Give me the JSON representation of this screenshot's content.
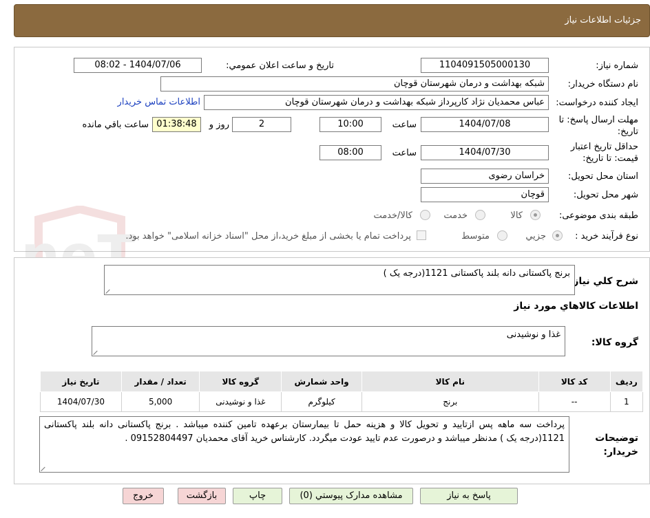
{
  "header": {
    "title": "جزئیات اطلاعات نیاز"
  },
  "watermark": {
    "text": "AriaTender.neT"
  },
  "form": {
    "need_number_label": "شماره نیاز:",
    "need_number": "1104091505000130",
    "announce_label": "تاریخ و ساعت اعلان عمومي:",
    "announce_value": "1404/07/06 - 08:02",
    "buyer_label": "نام دستگاه خریدار:",
    "buyer_value": "شبکه بهداشت و درمان شهرستان قوچان",
    "creator_label": "ایجاد کننده درخواست:",
    "creator_value": "عباس محمدیان نژاد کارپرداز شبکه بهداشت و درمان شهرستان قوچان",
    "contact_link": "اطلاعات تماس خریدار",
    "deadline_label": "مهلت ارسال پاسخ: تا تاریخ:",
    "deadline_date": "1404/07/08",
    "time_label": "ساعت",
    "deadline_time": "10:00",
    "days_value": "2",
    "days_label": "روز و",
    "remaining_value": "01:38:48",
    "remaining_label": "ساعت باقي مانده",
    "validity_label": "حداقل تاریخ اعتبار قیمت: تا تاریخ:",
    "validity_date": "1404/07/30",
    "validity_time": "08:00",
    "province_label": "استان محل تحویل:",
    "province_value": "خراسان رضوی",
    "city_label": "شهر محل تحویل:",
    "city_value": "قوچان",
    "category_label": "طبقه بندی موضوعی:",
    "category_options": [
      "کالا",
      "خدمت",
      "کالا/خدمت"
    ],
    "process_label": "نوع فرآیند خرید :",
    "process_options": [
      "جزیي",
      "متوسط"
    ],
    "process_note": "پرداخت تمام یا بخشی از مبلغ خرید،از محل \"اسناد خزانه اسلامی\" خواهد بود."
  },
  "details": {
    "summary_label": "شرح کلي نیاز:",
    "summary_value": "برنج پاکستانی دانه بلند پاکستانی 1121(درجه یک )",
    "goods_info_title": "اطلاعات کالاهاي مورد نیاز",
    "goods_group_label": "گروه کالا:",
    "goods_group_value": "غذا و نوشیدنی",
    "table": {
      "headers": [
        "ردیف",
        "کد کالا",
        "نام کالا",
        "واحد شمارش",
        "گروه کالا",
        "تعداد / مقدار",
        "تاریخ نیاز"
      ],
      "rows": [
        [
          "1",
          "--",
          "برنج",
          "کیلوگرم",
          "غذا و نوشیدنی",
          "5,000",
          "1404/07/30"
        ]
      ]
    },
    "buyer_notes_label": "توضیحات خریدار:",
    "buyer_notes_value": "پرداخت سه ماهه پس ازتایید و تحویل کالا  و هزینه حمل تا بیمارستان برعهده تامین کننده میباشد . برنج پاکستانی دانه بلند پاکستانی 1121(درجه یک ) مدنظر میباشد و درصورت عدم تایید عودت میگردد. کارشناس خرید آقای محمدیان 09152804497 ."
  },
  "buttons": {
    "reply": "پاسخ به نیاز",
    "attachments": "مشاهده مدارک پیوستي (0)",
    "print": "چاپ",
    "back": "بازگشت",
    "exit": "خروج"
  }
}
